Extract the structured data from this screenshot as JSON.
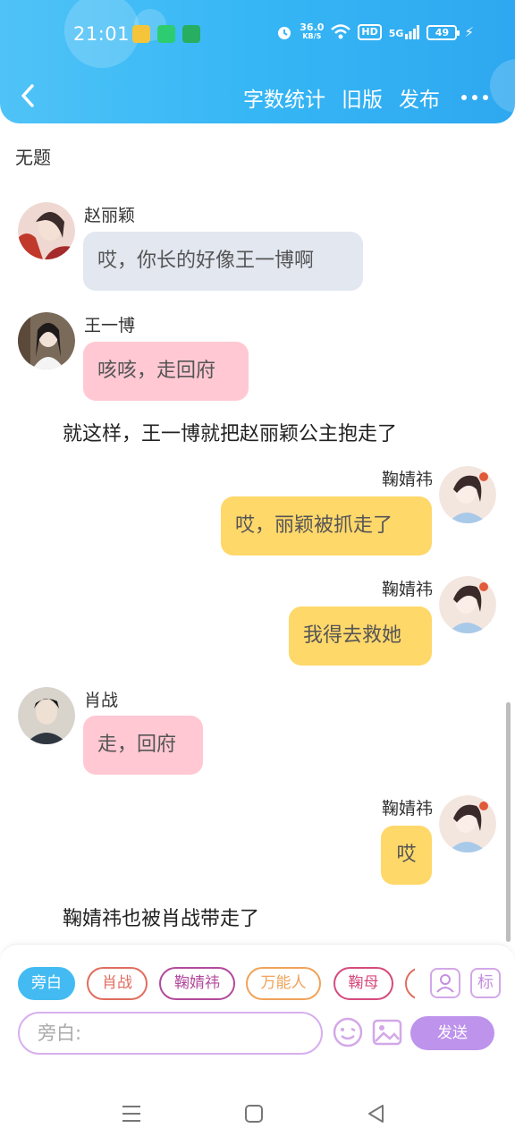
{
  "status_bar": {
    "time": "21:01",
    "net_speed_value": "36.0",
    "net_speed_unit": "KB/S",
    "hd": "HD",
    "signal": "5G",
    "battery": "49"
  },
  "nav": {
    "actions": [
      "字数统计",
      "旧版",
      "发布"
    ]
  },
  "doc": {
    "title": "无题"
  },
  "messages": [
    {
      "name": "赵丽颖",
      "text": "哎，你长的好像王一博啊"
    },
    {
      "name": "王一博",
      "text": "咳咳，走回府"
    },
    {
      "narration": "就这样，王一博就把赵丽颖公主抱走了"
    },
    {
      "name": "鞠婧祎",
      "text": "哎，丽颖被抓走了"
    },
    {
      "name": "鞠婧祎",
      "text": "我得去救她"
    },
    {
      "name": "肖战",
      "text": "走，回府"
    },
    {
      "name": "鞠婧祎",
      "text": "哎"
    },
    {
      "narration": "鞠婧祎也被肖战带走了"
    }
  ],
  "composer": {
    "chips": [
      "旁白",
      "肖战",
      "鞠婧祎",
      "万能人",
      "鞠母"
    ],
    "role_btn_label": "标",
    "input_placeholder": "旁白:",
    "send_label": "发送"
  },
  "colors": {
    "header": "#36b6f5",
    "bubble_gray": "#e2e7f0",
    "bubble_pink": "#ffc8d3",
    "bubble_yellow": "#ffd86a",
    "send_button": "#bd93ec"
  }
}
